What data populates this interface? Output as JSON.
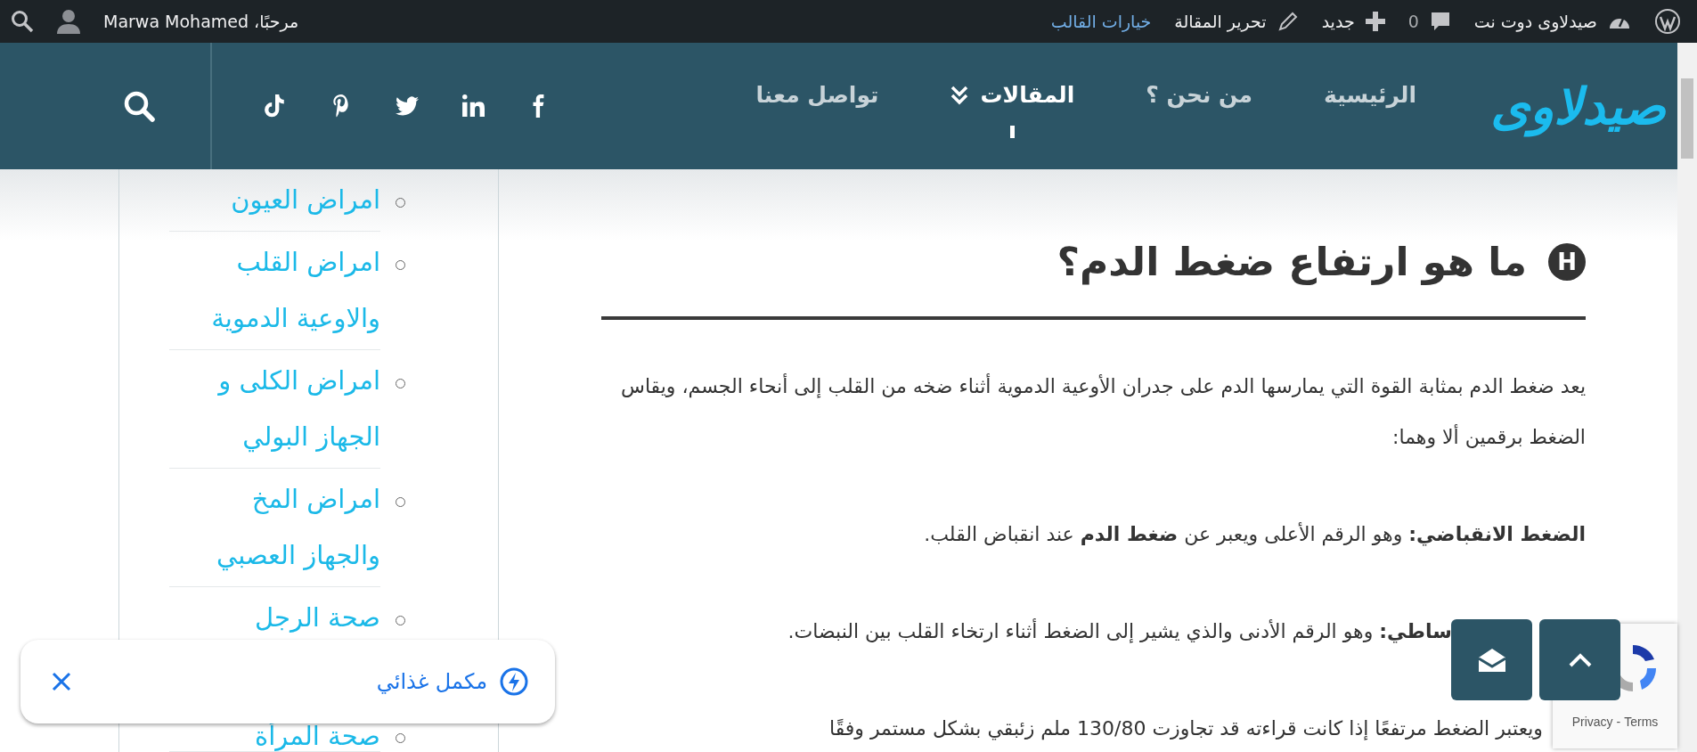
{
  "admin_bar": {
    "site": "صيدلاوى دوت نت",
    "comments": "0",
    "new": "جديد",
    "edit": "تحرير المقالة",
    "theme_options": "خيارات القالب",
    "greeting": "مرحبًا، Marwa Mohamed"
  },
  "header": {
    "logo": "صيدلاوى",
    "nav": [
      {
        "label": "الرئيسية",
        "selected": false,
        "kind": "link"
      },
      {
        "label": "من نحن ؟",
        "selected": false,
        "kind": "link"
      },
      {
        "label": "المقالات",
        "selected": true,
        "kind": "dropdown"
      },
      {
        "label": "تواصل معنا",
        "selected": false,
        "kind": "link"
      }
    ]
  },
  "sidebar": {
    "items": [
      "امراض العيون",
      "امراض القلب والاوعية الدموية",
      "امراض الكلى و الجهاز البولي",
      "امراض المخ والجهاز العصبي",
      "صحة الرجل",
      "صحة المرأة"
    ]
  },
  "article": {
    "heading": {
      "badge": "H",
      "text": "ما هو ارتفاع ضغط الدم؟"
    },
    "paragraphs": [
      "يعد ضغط الدم بمثابة القوة التي يمارسها الدم على جدران الأوعية الدموية أثناء ضخه من القلب إلى أنحاء الجسم، ويقاس الضغط برقمين ألا وهما:",
      "**الضغط الانقباضي:** وهو الرقم الأعلى ويعبر عن **ضغط الدم** عند انقباض القلب.",
      "**ساطي:** وهو الرقم الأدنى والذي يشير إلى الضغط أثناء ارتخاء القلب بين النبضات.",
      "ويعتبر الضغط مرتفعًا إذا كانت قراءته قد تجاوزت 130/80 ملم زئبقي بشكل مستمر وفقًا"
    ]
  },
  "popup": {
    "text": "مكمل غذائي"
  },
  "recaptcha": {
    "privacy": "Privacy",
    "separator": "-",
    "terms": "Terms"
  }
}
